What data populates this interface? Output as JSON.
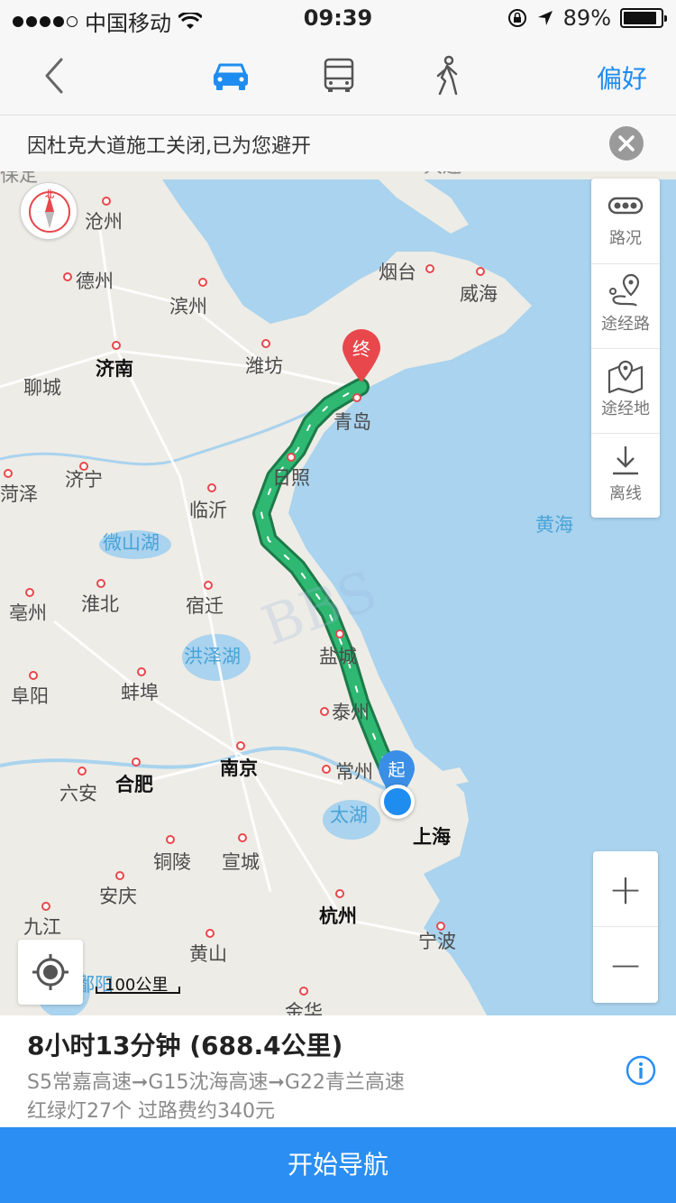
{
  "status_bar": {
    "carrier": "中国移动",
    "time": "09:39",
    "battery_percent": "89%",
    "battery_level": 0.89,
    "icons": [
      "signal-dots",
      "wifi-icon",
      "orientation-lock-icon",
      "location-arrow-icon",
      "battery-icon"
    ]
  },
  "nav": {
    "back_icon": "chevron-left-icon",
    "modes": [
      {
        "name": "car",
        "icon": "car-icon",
        "active": true
      },
      {
        "name": "bus",
        "icon": "bus-icon",
        "active": false
      },
      {
        "name": "walk",
        "icon": "walking-icon",
        "active": false
      }
    ],
    "preference_label": "偏好"
  },
  "notice": {
    "text": "因杜克大道施工关闭,已为您避开",
    "close_icon": "close-icon"
  },
  "map": {
    "cities": [
      {
        "label": "沧州"
      },
      {
        "label": "德州"
      },
      {
        "label": "滨州"
      },
      {
        "label": "济南"
      },
      {
        "label": "潍坊"
      },
      {
        "label": "烟台"
      },
      {
        "label": "威海"
      },
      {
        "label": "聊城"
      },
      {
        "label": "青岛"
      },
      {
        "label": "济宁"
      },
      {
        "label": "日照"
      },
      {
        "label": "临沂"
      },
      {
        "label": "菏泽"
      },
      {
        "label": "淮北"
      },
      {
        "label": "宿迁"
      },
      {
        "label": "亳州"
      },
      {
        "label": "盐城"
      },
      {
        "label": "阜阳"
      },
      {
        "label": "蚌埠"
      },
      {
        "label": "泰州"
      },
      {
        "label": "南京"
      },
      {
        "label": "常州"
      },
      {
        "label": "六安"
      },
      {
        "label": "合肥"
      },
      {
        "label": "上海"
      },
      {
        "label": "铜陵"
      },
      {
        "label": "宣城"
      },
      {
        "label": "安庆"
      },
      {
        "label": "杭州"
      },
      {
        "label": "九江"
      },
      {
        "label": "黄山"
      },
      {
        "label": "宁波"
      },
      {
        "label": "金华"
      },
      {
        "label": "大连"
      },
      {
        "label": "保定"
      }
    ],
    "water_labels": [
      {
        "label": "微山湖"
      },
      {
        "label": "洪泽湖"
      },
      {
        "label": "太湖"
      },
      {
        "label": "黄海"
      },
      {
        "label": "鄱阳"
      }
    ],
    "watermark": "BBS",
    "start_marker": "起",
    "end_marker": "终",
    "scale_label": "100公里",
    "route_color": "#2fb872",
    "sea_color": "#a9d3ee"
  },
  "tools": [
    {
      "icon": "traffic-icon",
      "label": "路况"
    },
    {
      "icon": "via-route-icon",
      "label": "途经路"
    },
    {
      "icon": "via-place-icon",
      "label": "途经地"
    },
    {
      "icon": "download-icon",
      "label": "离线"
    }
  ],
  "compass": {
    "label": "北"
  },
  "zoom": {
    "in": "+",
    "out": "−"
  },
  "route": {
    "summary": "8小时13分钟 (688.4公里)",
    "roads": "S5常嘉高速➞G15沈海高速➞G22青兰高速",
    "extra": "红绿灯27个 过路费约340元"
  },
  "start_button": "开始导航",
  "colors": {
    "accent": "#2a8ef2",
    "marker_end": "#e8474c",
    "marker_start": "#3a8ee6"
  }
}
